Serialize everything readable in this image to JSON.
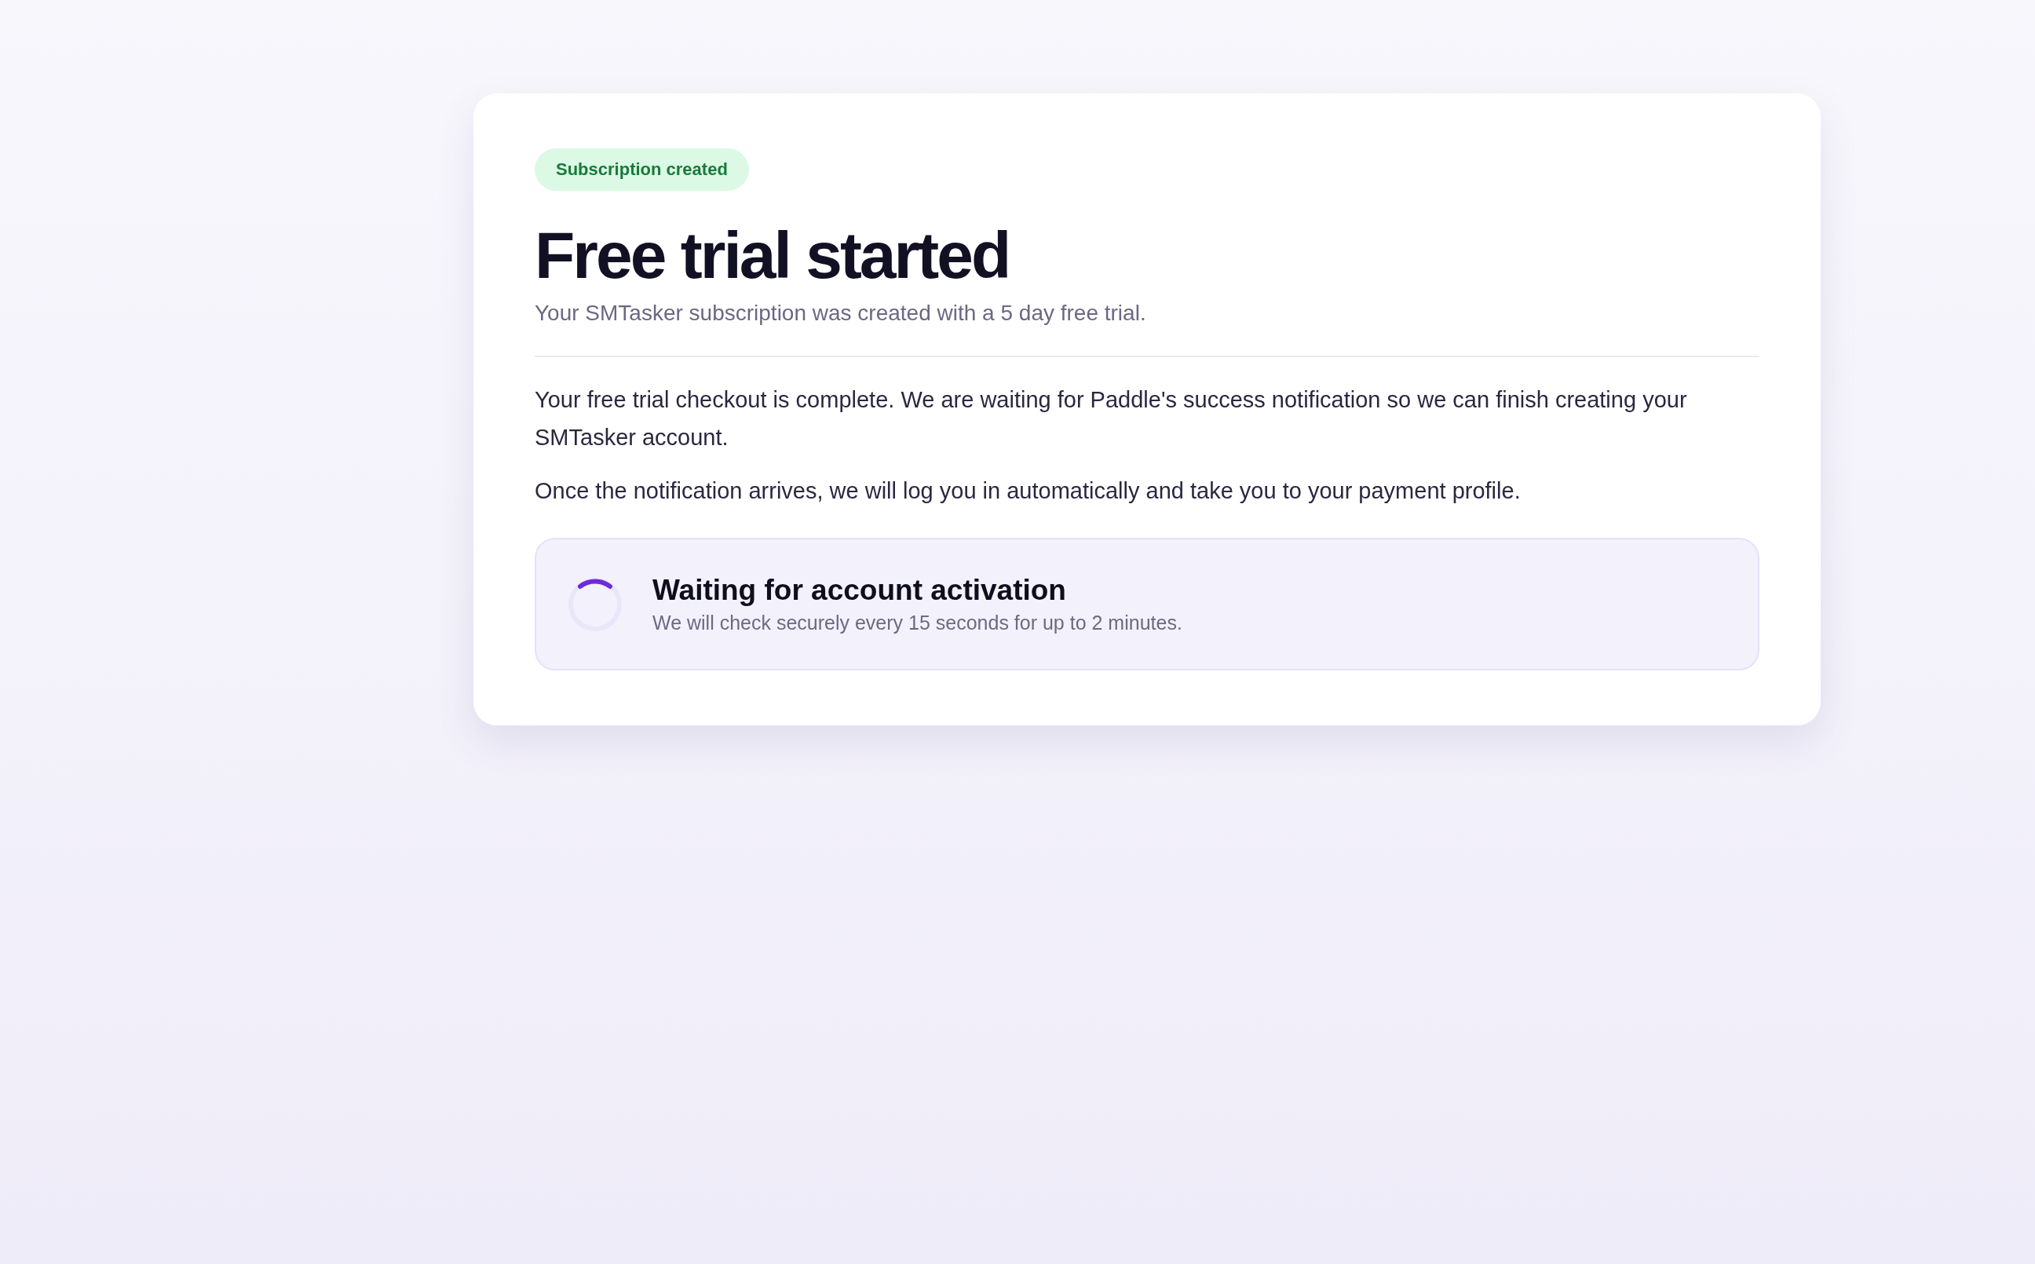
{
  "badge": "Subscription created",
  "title": "Free trial started",
  "subtitle": "Your SMTasker subscription was created with a 5 day free trial.",
  "paragraphs": [
    "Your free trial checkout is complete. We are waiting for Paddle's success notification so we can finish creating your SMTasker account.",
    "Once the notification arrives, we will log you in automatically and take you to your payment profile."
  ],
  "status": {
    "title": "Waiting for account activation",
    "detail": "We will check securely every 15 seconds for up to 2 minutes."
  }
}
